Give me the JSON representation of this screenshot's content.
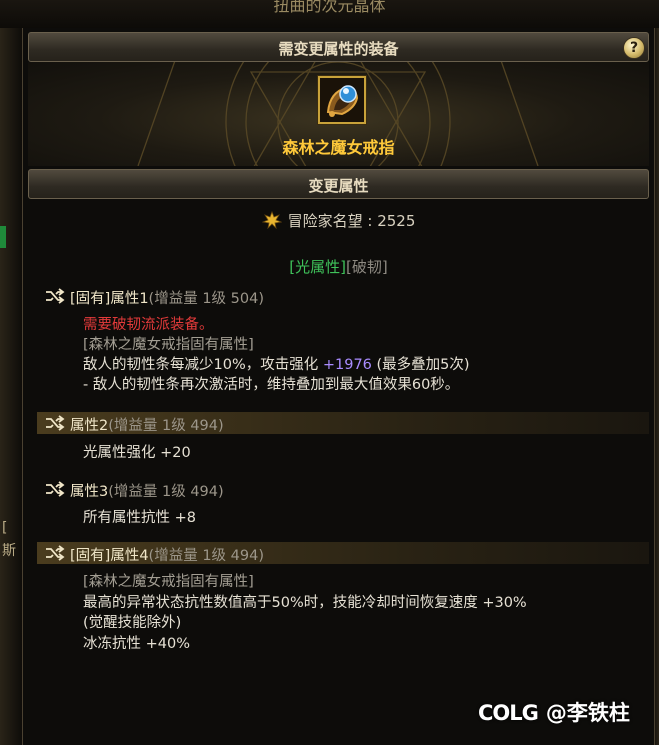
{
  "top_caption": "扭曲的次元晶体",
  "left_edge_chars": [
    "[",
    "斯"
  ],
  "header": {
    "title": "需变更属性的装备",
    "help": "?"
  },
  "item": {
    "name": "森林之魔女戒指",
    "icon": "ring-gem-icon"
  },
  "section2": {
    "title": "变更属性"
  },
  "reputation": {
    "label": "冒险家名望 : 2525"
  },
  "tags": {
    "light": "[光属性]",
    "break": "[破韧]"
  },
  "attributes": [
    {
      "name": "[固有]属性1",
      "gain": "(增益量 1级 504)",
      "highlighted": false,
      "lines": [
        {
          "text": "需要破韧流派装备。",
          "style": "red"
        },
        {
          "text": "[森林之魔女戒指固有属性]",
          "style": "gray"
        },
        {
          "text": "敌人的韧性条每减少10%，攻击强化",
          "style": "white",
          "value": "+1976",
          "suffix": "(最多叠加5次)"
        },
        {
          "text": "- 敌人的韧性条再次激活时，维持叠加到最大值效果60秒。",
          "style": "white"
        }
      ]
    },
    {
      "name": "属性2",
      "gain": "(增益量 1级 494)",
      "highlighted": true,
      "lines": [
        {
          "text": "光属性强化 +20",
          "style": "white"
        }
      ]
    },
    {
      "name": "属性3",
      "gain": "(增益量 1级 494)",
      "highlighted": false,
      "lines": [
        {
          "text": "所有属性抗性 +8",
          "style": "white"
        }
      ]
    },
    {
      "name": "[固有]属性4",
      "gain": "(增益量 1级 494)",
      "highlighted": true,
      "lines": [
        {
          "text": "[森林之魔女戒指固有属性]",
          "style": "gray"
        },
        {
          "text": "最高的异常状态抗性数值高于50%时，技能冷却时间恢复速度 +30%",
          "style": "white"
        },
        {
          "text": "(觉醒技能除外)",
          "style": "white"
        },
        {
          "text": "冰冻抗性 +40%",
          "style": "white"
        }
      ]
    }
  ],
  "watermark": {
    "logo": "COLG",
    "author": "@李铁柱"
  },
  "colors": {
    "gold": "#ffc93a",
    "green": "#3fc25a",
    "red": "#e23a3a",
    "purple": "#a98cff"
  }
}
